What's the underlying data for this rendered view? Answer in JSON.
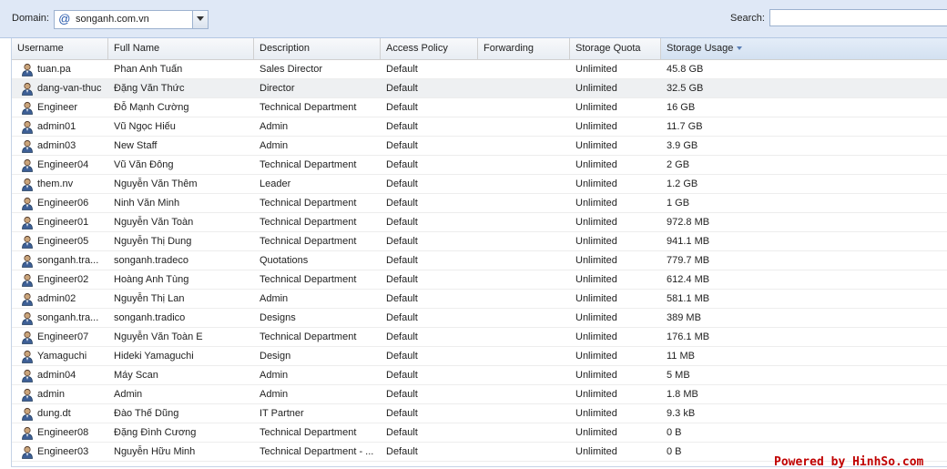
{
  "toolbar": {
    "domain_label": "Domain:",
    "domain_value": "songanh.com.vn",
    "search_label": "Search:",
    "search_value": ""
  },
  "columns": [
    "Username",
    "Full Name",
    "Description",
    "Access Policy",
    "Forwarding",
    "Storage Quota",
    "Storage Usage"
  ],
  "sorted_column": "Storage Usage",
  "rows": [
    [
      "tuan.pa",
      "Phan Anh Tuấn",
      "Sales Director",
      "Default",
      "",
      "Unlimited",
      "45.8 GB"
    ],
    [
      "dang-van-thuc",
      "Đặng Văn Thức",
      "Director",
      "Default",
      "",
      "Unlimited",
      "32.5 GB"
    ],
    [
      "Engineer",
      "Đỗ Mạnh Cường",
      "Technical Department",
      "Default",
      "",
      "Unlimited",
      "16 GB"
    ],
    [
      "admin01",
      "Vũ Ngọc Hiếu",
      "Admin",
      "Default",
      "",
      "Unlimited",
      "11.7 GB"
    ],
    [
      "admin03",
      "New Staff",
      "Admin",
      "Default",
      "",
      "Unlimited",
      "3.9 GB"
    ],
    [
      "Engineer04",
      "Vũ Văn Đông",
      "Technical Department",
      "Default",
      "",
      "Unlimited",
      "2 GB"
    ],
    [
      "them.nv",
      "Nguyễn Văn Thêm",
      "Leader",
      "Default",
      "",
      "Unlimited",
      "1.2 GB"
    ],
    [
      "Engineer06",
      "Ninh Văn Minh",
      "Technical Department",
      "Default",
      "",
      "Unlimited",
      "1 GB"
    ],
    [
      "Engineer01",
      "Nguyễn Văn Toàn",
      "Technical Department",
      "Default",
      "",
      "Unlimited",
      "972.8 MB"
    ],
    [
      "Engineer05",
      "Nguyễn Thị Dung",
      "Technical Department",
      "Default",
      "",
      "Unlimited",
      "941.1 MB"
    ],
    [
      "songanh.tra...",
      "songanh.tradeco",
      "Quotations",
      "Default",
      "",
      "Unlimited",
      "779.7 MB"
    ],
    [
      "Engineer02",
      "Hoàng Anh Tùng",
      "Technical Department",
      "Default",
      "",
      "Unlimited",
      "612.4 MB"
    ],
    [
      "admin02",
      "Nguyễn Thị Lan",
      "Admin",
      "Default",
      "",
      "Unlimited",
      "581.1 MB"
    ],
    [
      "songanh.tra...",
      "songanh.tradico",
      "Designs",
      "Default",
      "",
      "Unlimited",
      "389 MB"
    ],
    [
      "Engineer07",
      "Nguyễn Văn Toàn E",
      "Technical Department",
      "Default",
      "",
      "Unlimited",
      "176.1 MB"
    ],
    [
      "Yamaguchi",
      "Hideki Yamaguchi",
      "Design",
      "Default",
      "",
      "Unlimited",
      "11 MB"
    ],
    [
      "admin04",
      "Máy Scan",
      "Admin",
      "Default",
      "",
      "Unlimited",
      "5 MB"
    ],
    [
      "admin",
      "Admin",
      "Admin",
      "Default",
      "",
      "Unlimited",
      "1.8 MB"
    ],
    [
      "dung.dt",
      "Đào Thế Dũng",
      "IT Partner",
      "Default",
      "",
      "Unlimited",
      "9.3 kB"
    ],
    [
      "Engineer08",
      "Đặng Đình Cương",
      "Technical Department",
      "Default",
      "",
      "Unlimited",
      "0 B"
    ],
    [
      "Engineer03",
      "Nguyễn Hữu Minh",
      "Technical Department - ...",
      "Default",
      "",
      "Unlimited",
      "0 B"
    ]
  ],
  "selected_row": 1,
  "watermark": "Powered by HinhSo.com",
  "icons": {
    "domain": "at-icon",
    "user": "user-icon",
    "dropdown": "chevron-down-icon"
  },
  "colors": {
    "header_bg": "#dfe8f6",
    "watermark": "#c00000",
    "selected_row": "#eef0f2"
  }
}
